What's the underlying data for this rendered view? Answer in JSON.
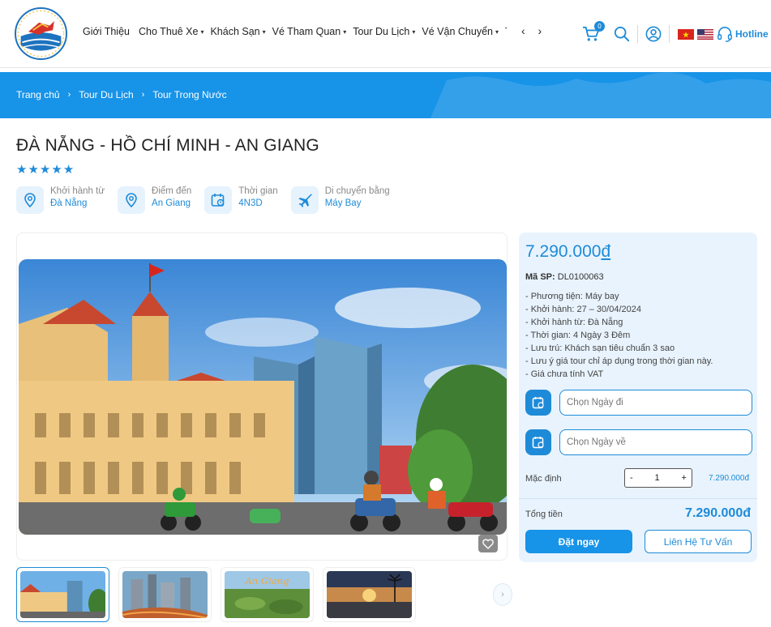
{
  "header": {
    "nav": [
      {
        "label": "Giới Thiệu",
        "caret": ""
      },
      {
        "label": "Cho Thuê Xe",
        "caret": "▾"
      },
      {
        "label": "Khách Sạn",
        "caret": "▾"
      },
      {
        "label": "Vé Tham Quan",
        "caret": "▾"
      },
      {
        "label": "Tour Du Lịch",
        "caret": "▾"
      },
      {
        "label": "Vé Vận Chuyển",
        "caret": "▾"
      },
      {
        "label": "T",
        "caret": ""
      }
    ],
    "nav_arrows": "‹ ›",
    "cart_count": "0",
    "hotline": "Hotline"
  },
  "breadcrumb": [
    "Trang chủ",
    "Tour Du Lịch",
    "Tour Trong Nước"
  ],
  "tour": {
    "title": "ĐÀ NẴNG - HỒ CHÍ MINH - AN GIANG",
    "rating": 5,
    "info": [
      {
        "icon": "location-pin-icon",
        "label": "Khởi hành từ",
        "value": "Đà Nẵng"
      },
      {
        "icon": "location-pin-icon",
        "label": "Điểm đến",
        "value": "An Giang"
      },
      {
        "icon": "calendar-clock-icon",
        "label": "Thời gian",
        "value": "4N3D"
      },
      {
        "icon": "airplane-icon",
        "label": "Di chuyển bằng",
        "value": "Máy Bay"
      }
    ]
  },
  "booking": {
    "price": "7.290.000",
    "currency": "đ",
    "sku_label": "Mã SP:",
    "sku": "DL0100063",
    "details": [
      "- Phương tiện: Máy bay",
      "- Khởi hành: 27 – 30/04/2024",
      "- Khởi hành từ: Đà Nẵng",
      "- Thời gian: 4 Ngày 3 Đêm",
      "- Lưu trú: Khách sạn tiêu chuẩn 3 sao",
      "- Lưu ý giá tour chỉ áp dụng trong thời gian này.",
      "- Giá chưa tính VAT"
    ],
    "depart_placeholder": "Chọn Ngày đi",
    "return_placeholder": "Chọn Ngày về",
    "qty_label": "Mặc định",
    "qty_minus": "-",
    "qty_value": "1",
    "qty_plus": "+",
    "qty_price": "7.290.000đ",
    "total_label": "Tổng tiền",
    "total_value": "7.290.000đ",
    "book_label": "Đặt ngay",
    "contact_label": "Liên Hệ Tư Vấn"
  },
  "colors": {
    "accent": "#1e8bd8",
    "banner": "#1793e8",
    "panel": "#e8f3fd"
  }
}
